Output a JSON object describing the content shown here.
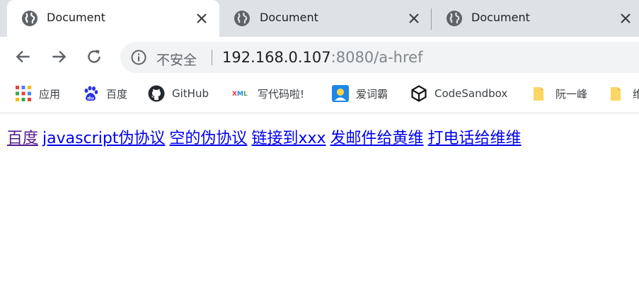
{
  "tabs": [
    {
      "title": "Document",
      "active": true
    },
    {
      "title": "Document",
      "active": false
    },
    {
      "title": "Document",
      "active": false
    }
  ],
  "toolbar": {
    "security_label": "不安全",
    "url_host": "192.168.0.107",
    "url_rest": ":8080/a-href"
  },
  "bookmarks": [
    {
      "label": "应用",
      "icon": "apps-grid-icon"
    },
    {
      "label": "百度",
      "icon": "baidu-paw-icon"
    },
    {
      "label": "GitHub",
      "icon": "github-icon"
    },
    {
      "label": "写代码啦!",
      "icon": "xml-icon"
    },
    {
      "label": "爱词霸",
      "icon": "iciba-icon"
    },
    {
      "label": "CodeSandbox",
      "icon": "codesandbox-icon"
    },
    {
      "label": "阮一峰",
      "icon": "folder-icon"
    },
    {
      "label": "维",
      "icon": "folder-icon"
    }
  ],
  "links": [
    {
      "text": "百度",
      "visited": true
    },
    {
      "text": "javascript伪协议",
      "visited": false
    },
    {
      "text": "空的伪协议",
      "visited": false
    },
    {
      "text": "链接到xxx",
      "visited": false
    },
    {
      "text": "发邮件给黄维",
      "visited": false
    },
    {
      "text": "打电话给维维",
      "visited": false
    }
  ],
  "colors": {
    "tabstrip_bg": "#dee1e6",
    "omnibox_bg": "#f1f3f4",
    "link": "#0000ee",
    "visited_link": "#551a8b"
  }
}
